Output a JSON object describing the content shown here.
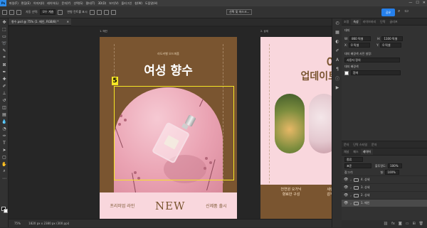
{
  "menubar": {
    "logo": "Ps",
    "items": [
      "파일(F)",
      "편집(E)",
      "이미지(I)",
      "레이어(L)",
      "문자(Y)",
      "선택(S)",
      "필터(T)",
      "3D(D)",
      "보기(V)",
      "플러그인",
      "창(W)",
      "도움말(H)"
    ],
    "window_controls": [
      "—",
      "☐",
      "✕"
    ]
  },
  "options": {
    "auto_select_label": "자동 선택:",
    "auto_select_value": "모두 계층",
    "transform_label": "변형 컨트롤 표시",
    "select_mask_button": "선택 및 마스크...",
    "share_button": "공유"
  },
  "document": {
    "tab_title": "향수.psd @ 75% (1. 메인, RGB/8) *",
    "artboards": [
      {
        "label": "1. 메인",
        "subtitle": "라도커벨 오드퍼퓸",
        "title": "여성 향수",
        "badge": "5",
        "footer_left": "프리미엄 라인",
        "footer_center": "NEW",
        "footer_right": "신제품 출시"
      },
      {
        "label": "2. 상세",
        "title_line1": "이",
        "title_line2": "업데이트",
        "bottom_left": "천연원 오가닉\n향료만 구성",
        "bottom_right": "세련\n감각"
      }
    ]
  },
  "status": {
    "zoom": "75%",
    "dimensions": "1820 px x 2380 px (300 ppi)"
  },
  "properties_panel": {
    "tabs": [
      "조정",
      "속성",
      "라이브러리",
      "단락",
      "글리프"
    ],
    "active_tab": "속성",
    "section": "대지",
    "w_label": "W:",
    "w_value": "860 픽셀",
    "h_label": "H:",
    "h_value": "1100 픽셀",
    "x_label": "X:",
    "x_value": "0 픽셀",
    "y_label": "Y:",
    "y_value": "0 픽셀",
    "preset_label": "대지 배경색 사전 설정:",
    "preset_value": "사용자 정의",
    "bg_label": "대지 배경색",
    "bg_value": "흰색"
  },
  "layers_panel": {
    "tabs": [
      "채널",
      "패스",
      "레이어"
    ],
    "top_tabs": [
      "문자",
      "단락 스타일",
      "문자"
    ],
    "kind_filter": "종류",
    "blend_mode": "표준",
    "opacity_label": "불투명도:",
    "opacity_value": "100%",
    "lock_label": "잠그기:",
    "fill_label": "칠:",
    "fill_value": "100%",
    "layers": [
      {
        "name": "4. 상세",
        "selected": false
      },
      {
        "name": "3. 상세",
        "selected": false
      },
      {
        "name": "2. 상세",
        "selected": false
      },
      {
        "name": "1. 메인",
        "selected": true
      }
    ]
  },
  "toolbar": {
    "tools": [
      "move-tool",
      "artboard-tool",
      "marquee-tool",
      "lasso-tool",
      "quick-select-tool",
      "crop-tool",
      "frame-tool",
      "eyedropper-tool",
      "healing-tool",
      "brush-tool",
      "stamp-tool",
      "history-brush-tool",
      "eraser-tool",
      "gradient-tool",
      "blur-tool",
      "dodge-tool",
      "pen-tool",
      "type-tool",
      "path-select-tool",
      "shape-tool",
      "hand-tool",
      "zoom-tool"
    ]
  },
  "colors": {
    "accent": "#2680eb",
    "artboard_brown": "#7a5530",
    "artboard_pink": "#f9d7dd",
    "selection": "#f5e625"
  }
}
